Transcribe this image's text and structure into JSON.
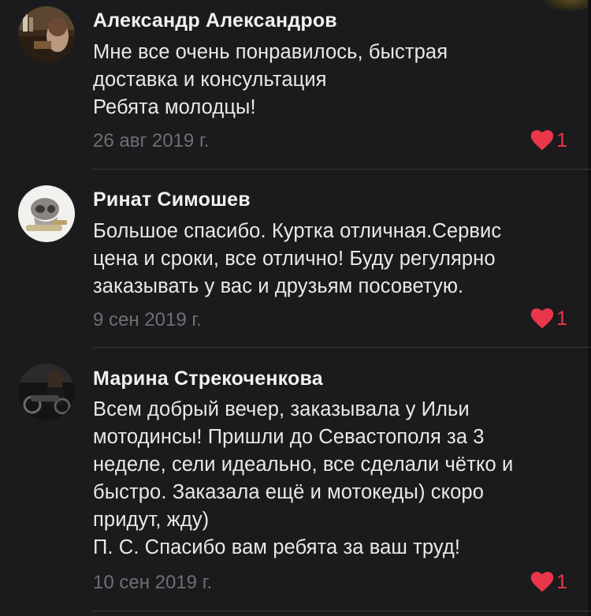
{
  "accent_color": "#e8364b",
  "comments": [
    {
      "author": "Александр Александров",
      "lines": [
        "Мне все очень понравилось, быстрая",
        "доставка и консультация",
        "Ребята молодцы!"
      ],
      "date": "26 авг 2019 г.",
      "likes": "1",
      "avatar_icon": "user-photo-avatar"
    },
    {
      "author": "Ринат Симошев",
      "lines": [
        "Большое спасибо. Куртка отличная.Сервис",
        "цена и сроки, все отлично! Буду регулярно",
        "заказывать у вас и друзьям посоветую."
      ],
      "date": "9 сен 2019 г.",
      "likes": "1",
      "avatar_icon": "user-photo-avatar"
    },
    {
      "author": "Марина Стрекоченкова",
      "lines": [
        "Всем добрый вечер, заказывала у Ильи",
        "мотодинсы! Пришли до Севастополя за 3",
        "неделе, сели идеально, все сделали чётко и",
        "быстро. Заказала ещё и мотокеды) скоро",
        "придут, жду)",
        "П. С. Спасибо вам ребята за ваш труд!"
      ],
      "date": "10 сен 2019 г.",
      "likes": "1",
      "avatar_icon": "user-photo-avatar"
    }
  ]
}
